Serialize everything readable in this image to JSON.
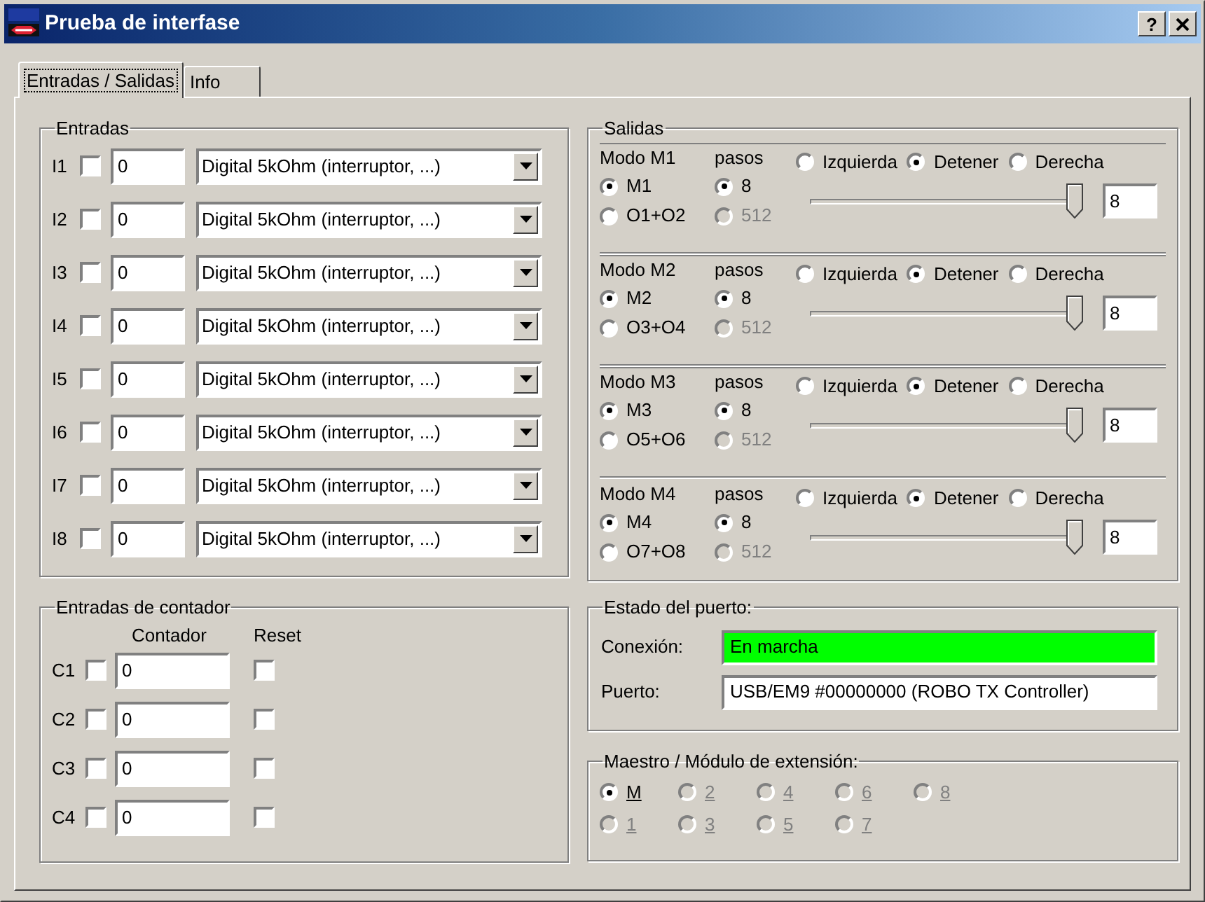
{
  "window": {
    "title": "Prueba de interfase",
    "help_button": "?"
  },
  "tabs": [
    {
      "label": "Entradas / Salidas",
      "selected": true
    },
    {
      "label": "Info",
      "selected": false
    }
  ],
  "inputs": {
    "title": "Entradas",
    "rows": [
      {
        "label": "I1",
        "checked": false,
        "value": "0",
        "mode": "Digital 5kOhm (interruptor, ...)"
      },
      {
        "label": "I2",
        "checked": false,
        "value": "0",
        "mode": "Digital 5kOhm (interruptor, ...)"
      },
      {
        "label": "I3",
        "checked": false,
        "value": "0",
        "mode": "Digital 5kOhm (interruptor, ...)"
      },
      {
        "label": "I4",
        "checked": false,
        "value": "0",
        "mode": "Digital 5kOhm (interruptor, ...)"
      },
      {
        "label": "I5",
        "checked": false,
        "value": "0",
        "mode": "Digital 5kOhm (interruptor, ...)"
      },
      {
        "label": "I6",
        "checked": false,
        "value": "0",
        "mode": "Digital 5kOhm (interruptor, ...)"
      },
      {
        "label": "I7",
        "checked": false,
        "value": "0",
        "mode": "Digital 5kOhm (interruptor, ...)"
      },
      {
        "label": "I8",
        "checked": false,
        "value": "0",
        "mode": "Digital 5kOhm (interruptor, ...)"
      }
    ]
  },
  "counters": {
    "title": "Entradas de contador",
    "column_headers": [
      "Contador",
      "Reset"
    ],
    "rows": [
      {
        "label": "C1",
        "checked": false,
        "value": "0",
        "reset": false
      },
      {
        "label": "C2",
        "checked": false,
        "value": "0",
        "reset": false
      },
      {
        "label": "C3",
        "checked": false,
        "value": "0",
        "reset": false
      },
      {
        "label": "C4",
        "checked": false,
        "value": "0",
        "reset": false
      }
    ]
  },
  "outputs": {
    "title": "Salidas",
    "motors": [
      {
        "mode_label": "Modo M1",
        "steps_label": "pasos",
        "modes": [
          {
            "label": "M1",
            "selected": true
          },
          {
            "label": "O1+O2",
            "selected": false
          }
        ],
        "steps": [
          {
            "label": "8",
            "selected": true,
            "disabled": false
          },
          {
            "label": "512",
            "selected": false,
            "disabled": true
          }
        ],
        "directions": [
          {
            "label": "Izquierda",
            "selected": false
          },
          {
            "label": "Detener",
            "selected": true
          },
          {
            "label": "Derecha",
            "selected": false
          }
        ],
        "level": 1,
        "speed": "8"
      },
      {
        "mode_label": "Modo M2",
        "steps_label": "pasos",
        "modes": [
          {
            "label": "M2",
            "selected": true
          },
          {
            "label": "O3+O4",
            "selected": false
          }
        ],
        "steps": [
          {
            "label": "8",
            "selected": true,
            "disabled": false
          },
          {
            "label": "512",
            "selected": false,
            "disabled": true
          }
        ],
        "directions": [
          {
            "label": "Izquierda",
            "selected": false
          },
          {
            "label": "Detener",
            "selected": true
          },
          {
            "label": "Derecha",
            "selected": false
          }
        ],
        "level": 1,
        "speed": "8"
      },
      {
        "mode_label": "Modo M3",
        "steps_label": "pasos",
        "modes": [
          {
            "label": "M3",
            "selected": true
          },
          {
            "label": "O5+O6",
            "selected": false
          }
        ],
        "steps": [
          {
            "label": "8",
            "selected": true,
            "disabled": false
          },
          {
            "label": "512",
            "selected": false,
            "disabled": true
          }
        ],
        "directions": [
          {
            "label": "Izquierda",
            "selected": false
          },
          {
            "label": "Detener",
            "selected": true
          },
          {
            "label": "Derecha",
            "selected": false
          }
        ],
        "level": 1,
        "speed": "8"
      },
      {
        "mode_label": "Modo M4",
        "steps_label": "pasos",
        "modes": [
          {
            "label": "M4",
            "selected": true
          },
          {
            "label": "O7+O8",
            "selected": false
          }
        ],
        "steps": [
          {
            "label": "8",
            "selected": true,
            "disabled": false
          },
          {
            "label": "512",
            "selected": false,
            "disabled": true
          }
        ],
        "directions": [
          {
            "label": "Izquierda",
            "selected": false
          },
          {
            "label": "Detener",
            "selected": true
          },
          {
            "label": "Derecha",
            "selected": false
          }
        ],
        "level": 1,
        "speed": "8"
      }
    ]
  },
  "port_status": {
    "title": "Estado del puerto:",
    "fields": [
      {
        "label": "Conexión:",
        "value": "En marcha",
        "color": "#00ff00"
      },
      {
        "label": "Puerto:",
        "value": "USB/EM9 #00000000 (ROBO TX Controller)",
        "color": "#ffffff"
      }
    ]
  },
  "extension": {
    "title": "Maestro / Módulo de extensión:",
    "rows": [
      [
        {
          "label": "M",
          "selected": true,
          "disabled": false
        },
        {
          "label": "2",
          "selected": false,
          "disabled": true
        },
        {
          "label": "4",
          "selected": false,
          "disabled": true
        },
        {
          "label": "6",
          "selected": false,
          "disabled": true
        },
        {
          "label": "8",
          "selected": false,
          "disabled": true
        }
      ],
      [
        {
          "label": "1",
          "selected": false,
          "disabled": true
        },
        {
          "label": "3",
          "selected": false,
          "disabled": true
        },
        {
          "label": "5",
          "selected": false,
          "disabled": true
        },
        {
          "label": "7",
          "selected": false,
          "disabled": true
        }
      ]
    ]
  }
}
